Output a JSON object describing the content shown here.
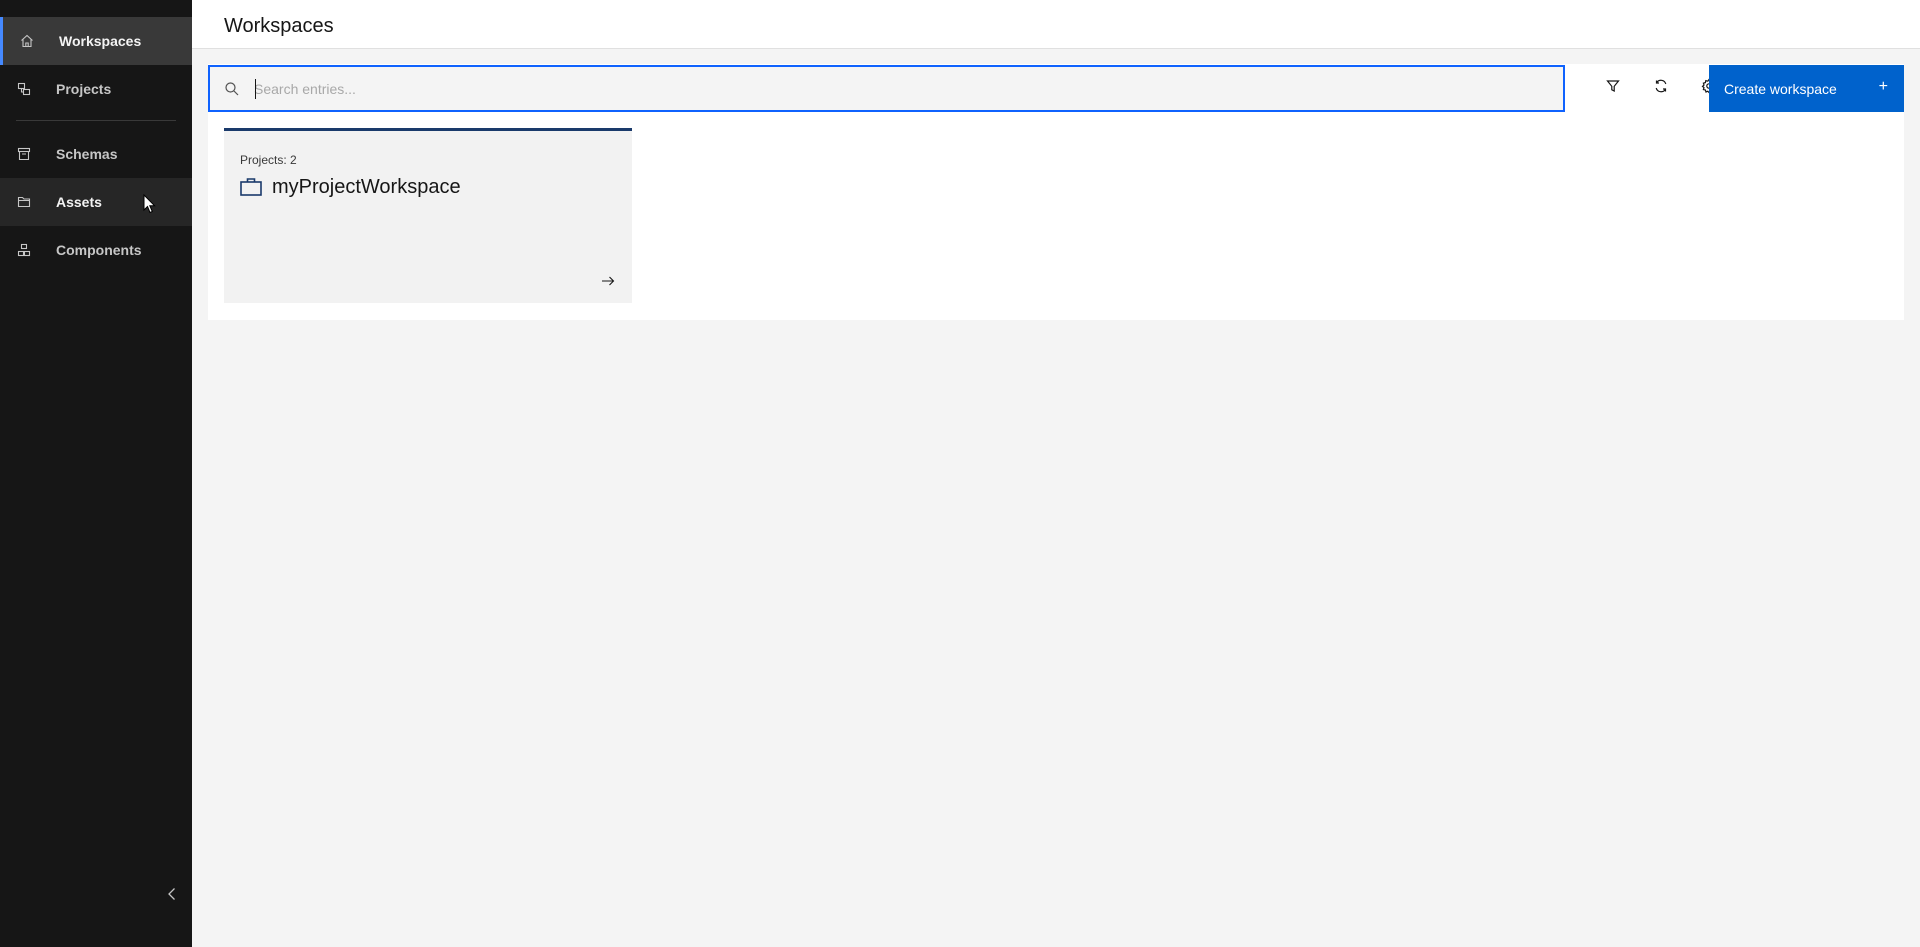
{
  "header": {
    "title": "Workspaces"
  },
  "sidebar": {
    "items": [
      {
        "label": "Workspaces",
        "icon": "home-icon",
        "state": "active"
      },
      {
        "label": "Projects",
        "icon": "projects-icon",
        "state": "normal"
      },
      {
        "label": "Schemas",
        "icon": "schema-icon",
        "state": "normal"
      },
      {
        "label": "Assets",
        "icon": "folder-icon",
        "state": "hover"
      },
      {
        "label": "Components",
        "icon": "components-icon",
        "state": "normal"
      }
    ],
    "collapse_icon": "chevron-left-icon"
  },
  "toolbar": {
    "search_placeholder": "Search entries...",
    "search_value": "",
    "filter_icon": "filter-icon",
    "refresh_icon": "refresh-icon",
    "settings_icon": "gear-icon",
    "create_label": "Create workspace",
    "create_icon": "+"
  },
  "cards": [
    {
      "meta": "Projects: 2",
      "title": "myProjectWorkspace",
      "icon": "briefcase-icon",
      "arrow_icon": "arrow-right-icon"
    }
  ],
  "colors": {
    "sidebar_bg": "#161616",
    "accent": "#0f62fe",
    "primary_button": "#0062cc",
    "active_indicator": "#4589ff",
    "card_top_border": "#1a3a6b"
  }
}
